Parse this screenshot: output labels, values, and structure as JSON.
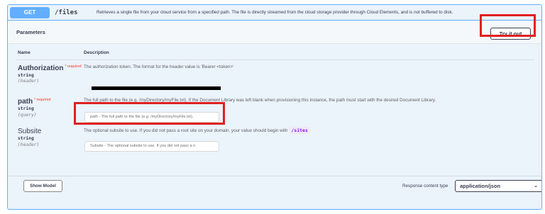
{
  "summary": {
    "method": "GET",
    "path": "/files",
    "description": "Retrieves a single file from your cloud service from a specified path. The file is directly streamed from the cloud storage provider through Cloud Elements, and is not buffered to disk."
  },
  "parameters": {
    "title": "Parameters",
    "try_label": "Try it out",
    "col_name": "Name",
    "col_description": "Description",
    "items": [
      {
        "name": "Authorization",
        "required_label": "* required",
        "type": "string",
        "in": "(header)",
        "description": "The authorization token. The format for the header value is 'Bearer <token>'"
      },
      {
        "name": "path",
        "required_label": "* required",
        "type": "string",
        "in": "(query)",
        "description": "The full path to the file (e.g. /myDirectory/myFile.txt). If the Document Library was left blank when provisioning this instance, the path must start with the desired Document Library.",
        "placeholder": "path - The full path to the file (e.g. /myDirectory/myFile.txt)."
      },
      {
        "name": "Subsite",
        "type": "string",
        "in": "(header)",
        "description": "The optional subsite to use. If you did not pass a root site on your domain, your value should begin with",
        "code": "/sites",
        "placeholder": "Subsite - The optional subsite to use. If you did not pass a n"
      }
    ]
  },
  "footer": {
    "show_model_label": "Show Model",
    "response_type_label": "Response content type",
    "response_type_value": "application/json"
  },
  "colors": {
    "get_blue": "#61affe",
    "highlight_red": "#e02020",
    "required_red": "#ff6060"
  }
}
